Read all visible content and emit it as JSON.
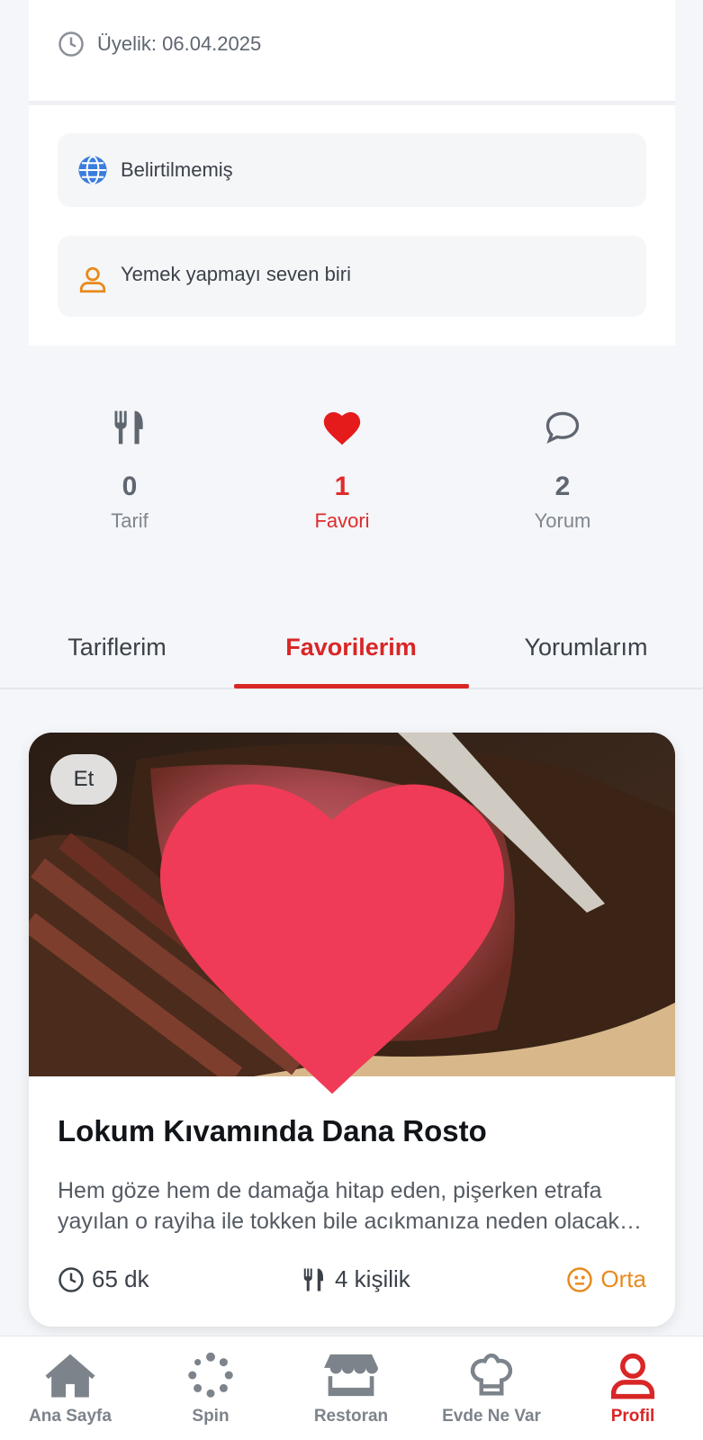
{
  "profile": {
    "member_since": "Üyelik: 06.04.2025",
    "website": "Belirtilmemiş",
    "bio": "Yemek yapmayı seven biri"
  },
  "stats": {
    "recipes": {
      "value": "0",
      "label": "Tarif"
    },
    "favorites": {
      "value": "1",
      "label": "Favori"
    },
    "comments": {
      "value": "2",
      "label": "Yorum"
    }
  },
  "tabs": [
    {
      "label": "Tariflerim",
      "active": false
    },
    {
      "label": "Favorilerim",
      "active": true
    },
    {
      "label": "Yorumlarım",
      "active": false
    }
  ],
  "recipe": {
    "category": "Et",
    "title": "Lokum Kıvamında Dana Rosto",
    "description": "Hem göze hem de damağa hitap eden, pişerken etrafa yayılan o rayiha ile tokken bile acıkmanıza neden olacak bir tarif.",
    "time": "65 dk",
    "servings": "4 kişilik",
    "difficulty": "Orta",
    "favorited": true
  },
  "nav": {
    "home": "Ana Sayfa",
    "spin": "Spin",
    "restaurant": "Restoran",
    "fridge": "Evde Ne Var",
    "profile": "Profil"
  },
  "colors": {
    "accent": "#d92626",
    "difficulty": "#e98a1d",
    "website_icon": "#3b7ddd",
    "bio_icon": "#e98a1d"
  }
}
